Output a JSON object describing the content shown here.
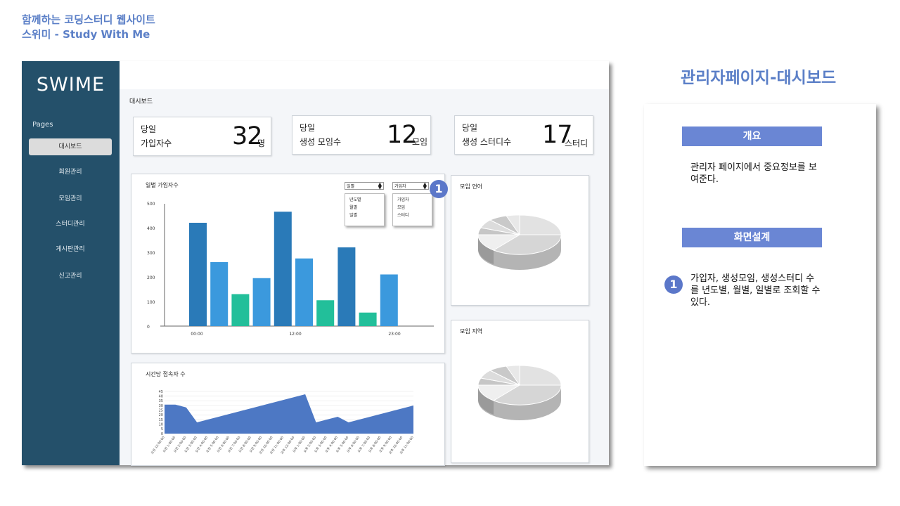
{
  "header": {
    "line1": "함께하는 코딩스터디 웹사이트",
    "line2": "스위미 - Study With Me"
  },
  "sidebar": {
    "logo": "SWIME",
    "section_label": "Pages",
    "items": [
      {
        "label": "대시보드",
        "active": true
      },
      {
        "label": "회원관리",
        "active": false
      },
      {
        "label": "모임관리",
        "active": false
      },
      {
        "label": "스터디관리",
        "active": false
      },
      {
        "label": "게시판관리",
        "active": false
      },
      {
        "label": "신고관리",
        "active": false
      }
    ]
  },
  "breadcrumb": "대시보드",
  "stats": [
    {
      "label1": "당일",
      "label2": "가입자수",
      "value": "32",
      "unit": "명"
    },
    {
      "label1": "당일",
      "label2": "생성 모임수",
      "value": "12",
      "unit": "모임"
    },
    {
      "label1": "당일",
      "label2": "생성 스터디수",
      "value": "17",
      "unit": "스터디"
    }
  ],
  "signup_panel": {
    "title": "일별 가입자수",
    "select1": {
      "value": "일별",
      "options": [
        "년도별",
        "월별",
        "일별"
      ]
    },
    "select2": {
      "value": "가입자",
      "options": [
        "가입자",
        "모임",
        "스터디"
      ]
    },
    "badge": "1"
  },
  "access_panel": {
    "title": "시간당 접속자 수"
  },
  "pie_panels": [
    {
      "title": "모임 언어"
    },
    {
      "title": "모임 지역"
    }
  ],
  "right": {
    "title": "관리자페이지-대시보드",
    "overview_label": "개요",
    "overview_text": "관리자 페이지에서 중요정보를 보여준다.",
    "design_label": "화면설계",
    "badge": "1",
    "design_text": "가입자, 생성모임, 생성스터디 수를 년도별, 월별, 일별로 조회할 수 있다."
  },
  "colors": {
    "sidebar": "#24506a",
    "accent": "#5b7fc7",
    "section": "#6a86d4",
    "area": "#4d78c4",
    "bar_dark": "#2a7ab8",
    "bar_light": "#3b99dd",
    "bar_green": "#22bf9a"
  },
  "chart_data": [
    {
      "type": "bar",
      "title": "일별 가입자수",
      "x_ticks": [
        "00:00",
        "12:00",
        "23:00"
      ],
      "ylim": [
        0,
        500
      ],
      "y_ticks": [
        0,
        100,
        200,
        300,
        400,
        500
      ],
      "values": [
        420,
        260,
        130,
        195,
        465,
        275,
        105,
        320,
        55,
        210
      ],
      "bar_colors": [
        "#2a7ab8",
        "#3b99dd",
        "#22bf9a",
        "#3b99dd",
        "#2a7ab8",
        "#3b99dd",
        "#22bf9a",
        "#2a7ab8",
        "#22bf9a",
        "#3b99dd"
      ]
    },
    {
      "type": "area",
      "title": "시간당 접속자 수",
      "ylim": [
        0,
        45
      ],
      "y_ticks": [
        0,
        5,
        10,
        15,
        20,
        25,
        30,
        35,
        40,
        45
      ],
      "categories": [
        "오전 12:00:00",
        "오전 1:00:00",
        "오전 2:00:00",
        "오전 3:00:00",
        "오전 4:00:00",
        "오전 5:00:00",
        "오전 6:00:00",
        "오전 7:00:00",
        "오전 8:00:00",
        "오전 9:00:00",
        "오전 10:00:00",
        "오전 11:00:00",
        "오후 12:00:00",
        "오후 1:00:00",
        "오후 2:00:00",
        "오후 3:00:00",
        "오후 4:00:00",
        "오후 5:00:00",
        "오후 6:00:00",
        "오후 7:00:00",
        "오후 8:00:00",
        "오후 9:00:00",
        "오후 10:00:00",
        "오후 11:00:00"
      ],
      "values": [
        31,
        31,
        28,
        12,
        15,
        18,
        21,
        24,
        27,
        30,
        33,
        36,
        39,
        42,
        12,
        15,
        18,
        12,
        15,
        18,
        21,
        24,
        27,
        30
      ]
    }
  ]
}
